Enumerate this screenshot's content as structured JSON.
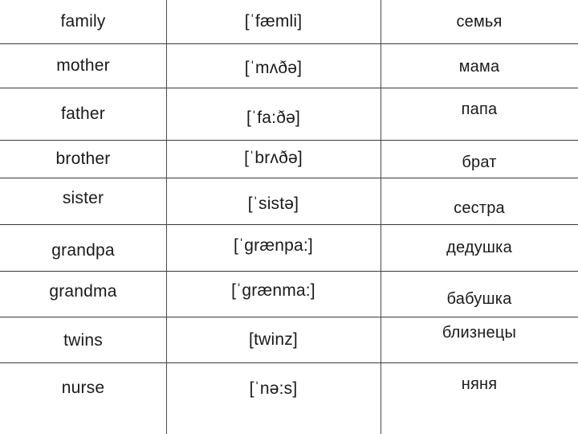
{
  "table": {
    "columns": [
      "english",
      "transcription",
      "russian"
    ],
    "rows": [
      {
        "english": "family",
        "transcription": "[ˈfæmli]",
        "russian": "семья",
        "height": 55,
        "offsets": {
          "english": 0,
          "transcription": 0,
          "russian": 0
        }
      },
      {
        "english": "mother",
        "transcription": "[ˈmʌðə]",
        "russian": "мама",
        "height": 55,
        "offsets": {
          "english": 0,
          "transcription": 3,
          "russian": 1
        }
      },
      {
        "english": "father",
        "transcription": "[ˈfa:ðə]",
        "russian": "папа",
        "height": 65,
        "offsets": {
          "english": 0,
          "transcription": 5,
          "russian": -6
        }
      },
      {
        "english": "brother",
        "transcription": "[ˈbrʌðə]",
        "russian": "брат",
        "height": 47,
        "offsets": {
          "english": 0,
          "transcription": -1,
          "russian": 4
        }
      },
      {
        "english": "sister",
        "transcription": "[ˈsistə]",
        "russian": "сестра",
        "height": 58,
        "offsets": {
          "english": -4,
          "transcription": 3,
          "russian": 8
        }
      },
      {
        "english": "grandpa",
        "transcription": "[ˈgrænpa:]",
        "russian": "дедушка",
        "height": 58,
        "offsets": {
          "english": 3,
          "transcription": -3,
          "russian": -1
        }
      },
      {
        "english": "grandma",
        "transcription": "[ˈgrænma:]",
        "russian": "бабушка",
        "height": 57,
        "offsets": {
          "english": -3,
          "transcription": -4,
          "russian": 6
        }
      },
      {
        "english": "twins",
        "transcription": "[twinz]",
        "russian": "близнецы",
        "height": 57,
        "offsets": {
          "english": 1,
          "transcription": 0,
          "russian": -9
        }
      },
      {
        "english": "nurse",
        "transcription": "[ˈnə:s]",
        "russian": "няня",
        "height": 88,
        "offsets": {
          "english": -13,
          "transcription": -12,
          "russian": -18
        }
      }
    ]
  },
  "style": {
    "background_color": "#ffffff",
    "text_color": "#1a1a1a",
    "rule_color": "#3a3a3a",
    "divider_color": "#4a4a4a"
  }
}
